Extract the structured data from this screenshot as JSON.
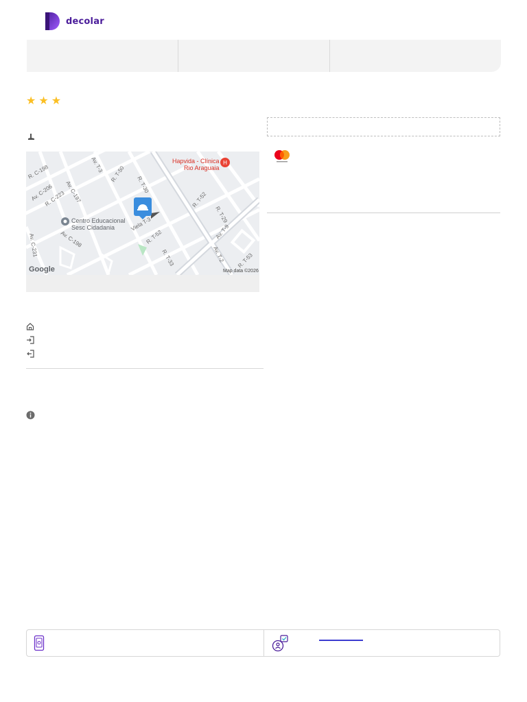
{
  "brand": {
    "name": "decolar",
    "color": "#4a1c9a",
    "accent": "#8b3dff"
  },
  "hotel": {
    "stars": 3,
    "star_color": "#fbbf24"
  },
  "map": {
    "streets": [
      "R. C-198",
      "Av. C-206",
      "R. C-223",
      "Av. C-197",
      "Av. T-3",
      "R. T-50",
      "R. T-30",
      "R. T-52",
      "R. T-29",
      "Av. T-9",
      "Av. C-231",
      "Av. C-198",
      "Viela T-3",
      "R. T-52",
      "R. T-33",
      "Av. T-2",
      "R. T-53"
    ],
    "poi_clinic": "Hapvida - Clínica Rio Araguaia",
    "poi_center": "Centro Educacional Sesc Cidadania",
    "attribution": "Google",
    "copyright": "Map data ©2026"
  },
  "payment": {
    "card": "mastercard"
  },
  "icons": {
    "address": "map-pin-icon",
    "house": "house-icon",
    "checkin": "checkin-icon",
    "checkout": "checkout-icon",
    "info": "info-icon",
    "phone": "phone-icon",
    "support": "support-agent-icon"
  }
}
